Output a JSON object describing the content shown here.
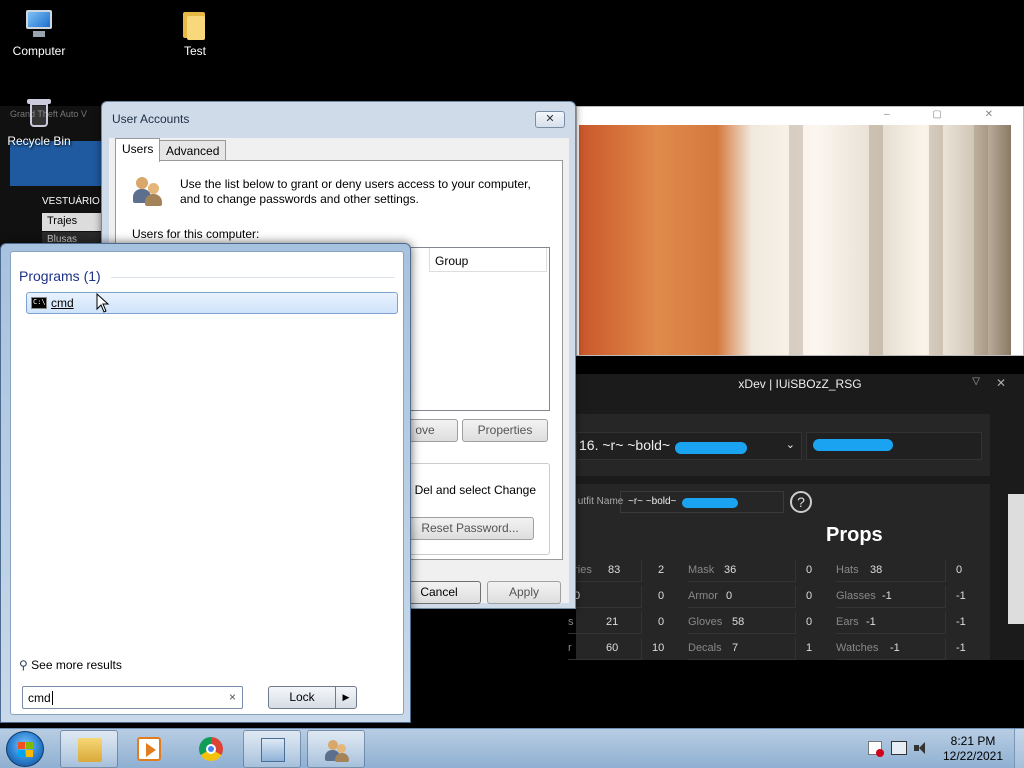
{
  "desktop": {
    "icons": [
      {
        "label": "Computer"
      },
      {
        "label": "Test"
      },
      {
        "label": "Recycle Bin"
      }
    ]
  },
  "gta_window": {
    "title": "Grand Theft Auto V",
    "menu_header": "VESTUÁRIO",
    "items": [
      "Trajes",
      "Blusas"
    ]
  },
  "xdev": {
    "title": "xDev | IUiSBOzZ_RSG",
    "selected_outfit": "16. ~r~ ~bold~",
    "outfit_name_label": "Outfit Name",
    "outfit_name_value": "~r~ ~bold~",
    "help_label": "?",
    "props_title": "Props",
    "rows": [
      {
        "left_k": "ories",
        "left_v": "83",
        "left_r": "2",
        "mid_k": "Mask",
        "mid_v": "36",
        "mid_r": "0",
        "prop_k": "Hats",
        "prop_v": "38",
        "prop_r": "0"
      },
      {
        "left_k": "",
        "left_v": "0",
        "left_r": "0",
        "mid_k": "Armor",
        "mid_v": "0",
        "mid_r": "0",
        "prop_k": "Glasses",
        "prop_v": "-1",
        "prop_r": "-1"
      },
      {
        "left_k": "s",
        "left_v": "21",
        "left_r": "0",
        "mid_k": "Gloves",
        "mid_v": "58",
        "mid_r": "0",
        "prop_k": "Ears",
        "prop_v": "-1",
        "prop_r": "-1"
      },
      {
        "left_k": "r",
        "left_v": "60",
        "left_r": "10",
        "mid_k": "Decals",
        "mid_v": "7",
        "mid_r": "1",
        "prop_k": "Watches",
        "prop_v": "-1",
        "prop_r": "-1"
      }
    ]
  },
  "user_accounts": {
    "title": "User Accounts",
    "close": "✕",
    "tabs": [
      "Users",
      "Advanced"
    ],
    "description": "Use the list below to grant or deny users access to your computer, and to change passwords and other settings.",
    "users_label": "Users for this computer:",
    "column_group": "Group",
    "remove_button": "ove",
    "properties_button": "Properties",
    "group_text": "Del and select Change",
    "reset_password_button": "Reset Password...",
    "cancel_button": "Cancel",
    "apply_button": "Apply"
  },
  "start_menu": {
    "programs_header": "Programs (1)",
    "result_label": "cmd",
    "see_more": "See more results",
    "search_value": "cmd",
    "clear_icon": "×",
    "lock_label": "Lock",
    "lock_arrow": "▶"
  },
  "taskbar": {
    "time": "8:21 PM",
    "date": "12/22/2021"
  }
}
